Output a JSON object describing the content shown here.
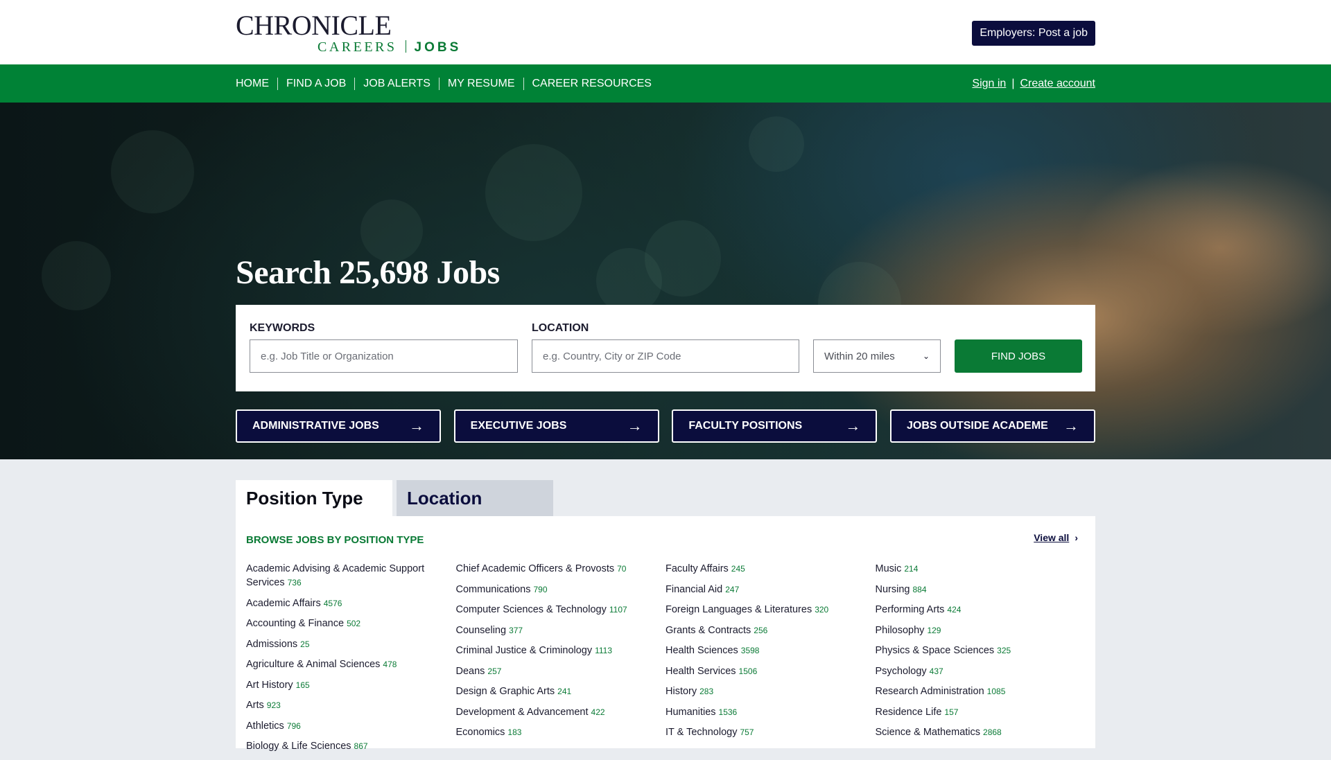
{
  "brand": {
    "line1": "CHRONICLE",
    "line2_careers": "CAREERS",
    "line2_jobs": "JOBS"
  },
  "header": {
    "post_job_label": "Employers: Post a job"
  },
  "nav": {
    "links": [
      "HOME",
      "FIND A JOB",
      "JOB ALERTS",
      "MY RESUME",
      "CAREER RESOURCES"
    ],
    "sign_in": "Sign in",
    "separator": "|",
    "create_account": "Create account"
  },
  "hero": {
    "title": "Search 25,698 Jobs",
    "keywords_label": "KEYWORDS",
    "keywords_placeholder": "e.g. Job Title or Organization",
    "location_label": "LOCATION",
    "location_placeholder": "e.g. Country, City or ZIP Code",
    "radius_selected": "Within 20 miles",
    "find_label": "FIND JOBS",
    "quick_links": [
      "ADMINISTRATIVE JOBS",
      "EXECUTIVE JOBS",
      "FACULTY POSITIONS",
      "JOBS OUTSIDE ACADEME"
    ]
  },
  "browse": {
    "tab_position": "Position Type",
    "tab_location": "Location",
    "heading": "BROWSE JOBS BY POSITION TYPE",
    "view_all": "View all",
    "columns": [
      [
        {
          "name": "Academic Advising & Academic Support Services",
          "count": "736"
        },
        {
          "name": "Academic Affairs",
          "count": "4576"
        },
        {
          "name": "Accounting & Finance",
          "count": "502"
        },
        {
          "name": "Admissions",
          "count": "25"
        },
        {
          "name": "Agriculture & Animal Sciences",
          "count": "478"
        },
        {
          "name": "Art History",
          "count": "165"
        },
        {
          "name": "Arts",
          "count": "923"
        },
        {
          "name": "Athletics",
          "count": "796"
        },
        {
          "name": "Biology & Life Sciences",
          "count": "867"
        }
      ],
      [
        {
          "name": "Chief Academic Officers & Provosts",
          "count": "70"
        },
        {
          "name": "Communications",
          "count": "790"
        },
        {
          "name": "Computer Sciences & Technology",
          "count": "1107"
        },
        {
          "name": "Counseling",
          "count": "377"
        },
        {
          "name": "Criminal Justice & Criminology",
          "count": "1113"
        },
        {
          "name": "Deans",
          "count": "257"
        },
        {
          "name": "Design & Graphic Arts",
          "count": "241"
        },
        {
          "name": "Development & Advancement",
          "count": "422"
        },
        {
          "name": "Economics",
          "count": "183"
        }
      ],
      [
        {
          "name": "Faculty Affairs",
          "count": "245"
        },
        {
          "name": "Financial Aid",
          "count": "247"
        },
        {
          "name": "Foreign Languages & Literatures",
          "count": "320"
        },
        {
          "name": "Grants & Contracts",
          "count": "256"
        },
        {
          "name": "Health Sciences",
          "count": "3598"
        },
        {
          "name": "Health Services",
          "count": "1506"
        },
        {
          "name": "History",
          "count": "283"
        },
        {
          "name": "Humanities",
          "count": "1536"
        },
        {
          "name": "IT & Technology",
          "count": "757"
        }
      ],
      [
        {
          "name": "Music",
          "count": "214"
        },
        {
          "name": "Nursing",
          "count": "884"
        },
        {
          "name": "Performing Arts",
          "count": "424"
        },
        {
          "name": "Philosophy",
          "count": "129"
        },
        {
          "name": "Physics & Space Sciences",
          "count": "325"
        },
        {
          "name": "Psychology",
          "count": "437"
        },
        {
          "name": "Research Administration",
          "count": "1085"
        },
        {
          "name": "Residence Life",
          "count": "157"
        },
        {
          "name": "Science & Mathematics",
          "count": "2868"
        }
      ]
    ]
  }
}
